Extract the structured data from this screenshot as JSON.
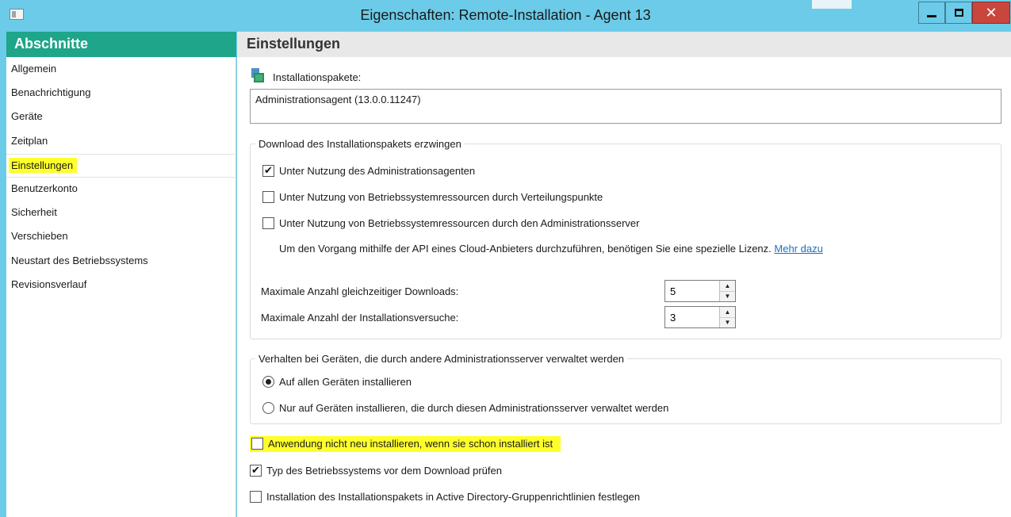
{
  "window": {
    "title": "Eigenschaften: Remote-Installation - Agent 13",
    "controls": [
      "minimize-icon",
      "maximize-icon",
      "close-icon"
    ]
  },
  "sidebar": {
    "header": "Abschnitte",
    "items": [
      {
        "label": "Allgemein"
      },
      {
        "label": "Benachrichtigung"
      },
      {
        "label": "Geräte"
      },
      {
        "label": "Zeitplan"
      },
      {
        "label": "Einstellungen",
        "selected": true
      },
      {
        "label": "Benutzerkonto"
      },
      {
        "label": "Sicherheit"
      },
      {
        "label": "Verschieben"
      },
      {
        "label": "Neustart des Betriebssystems"
      },
      {
        "label": "Revisionsverlauf"
      }
    ]
  },
  "content": {
    "header": "Einstellungen",
    "packages_label": "Installationspakete:",
    "packages_value": "Administrationsagent (13.0.0.11247)",
    "download_group": {
      "legend": "Download des Installationspakets erzwingen",
      "opt_agent": {
        "label": "Unter Nutzung des Administrationsagenten",
        "checked": true
      },
      "opt_distribution": {
        "label": "Unter Nutzung von Betriebssystemressourcen durch Verteilungspunkte",
        "checked": false
      },
      "opt_server": {
        "label": "Unter Nutzung von Betriebssystemressourcen durch den Administrationsserver",
        "checked": false
      },
      "note": "Um den Vorgang mithilfe der API eines Cloud-Anbieters durchzuführen, benötigen Sie eine spezielle Lizenz.",
      "note_link": "Mehr dazu",
      "max_downloads_label": "Maximale Anzahl gleichzeitiger Downloads:",
      "max_downloads_value": "5",
      "max_attempts_label": "Maximale Anzahl der Installationsversuche:",
      "max_attempts_value": "3"
    },
    "behavior_group": {
      "legend": "Verhalten bei Geräten, die durch andere Administrationsserver verwaltet werden",
      "radio_all": {
        "label": "Auf allen Geräten installieren",
        "selected": true
      },
      "radio_own": {
        "label": "Nur auf Geräten installieren, die durch diesen Administrationsserver verwaltet werden",
        "selected": false
      }
    },
    "no_reinstall": {
      "label": "Anwendung nicht neu installieren, wenn sie schon installiert ist",
      "checked": false
    },
    "check_os": {
      "label": "Typ des Betriebssystems vor dem Download prüfen",
      "checked": true
    },
    "ad_policy": {
      "label": "Installation des Installationspakets in Active Directory-Gruppenrichtlinien festlegen",
      "checked": false
    }
  },
  "colors": {
    "titlebar": "#6ccbe9",
    "sidebar_header": "#1ea58a",
    "highlight": "#ffff2a",
    "link": "#1d6fc4",
    "close_button": "#c9463d"
  }
}
